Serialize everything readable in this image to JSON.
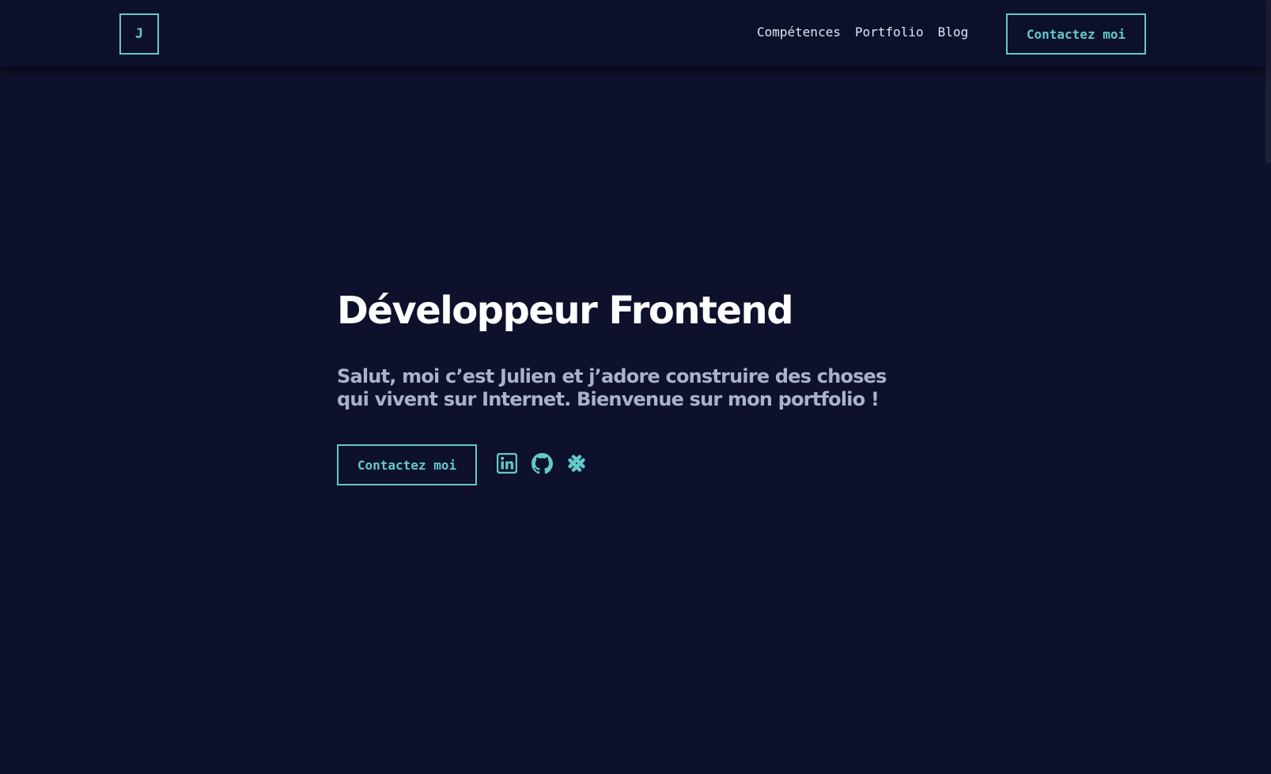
{
  "header": {
    "logo_text": "J",
    "nav": [
      {
        "label": "Compétences"
      },
      {
        "label": "Portfolio"
      },
      {
        "label": "Blog"
      }
    ],
    "cta_label": "Contactez moi"
  },
  "hero": {
    "title": "Développeur Frontend",
    "subtitle": "Salut, moi c’est Julien et j’adore construire des choses qui vivent sur Internet. Bienvenue sur mon portfolio !",
    "cta_label": "Contactez moi",
    "socials": [
      {
        "icon": "linkedin-icon"
      },
      {
        "icon": "github-icon"
      },
      {
        "icon": "malt-icon"
      }
    ]
  },
  "colors": {
    "background": "#0d112b",
    "accent": "#64c8c8",
    "heading": "#ffffff",
    "body_text": "#a9b1cd"
  }
}
